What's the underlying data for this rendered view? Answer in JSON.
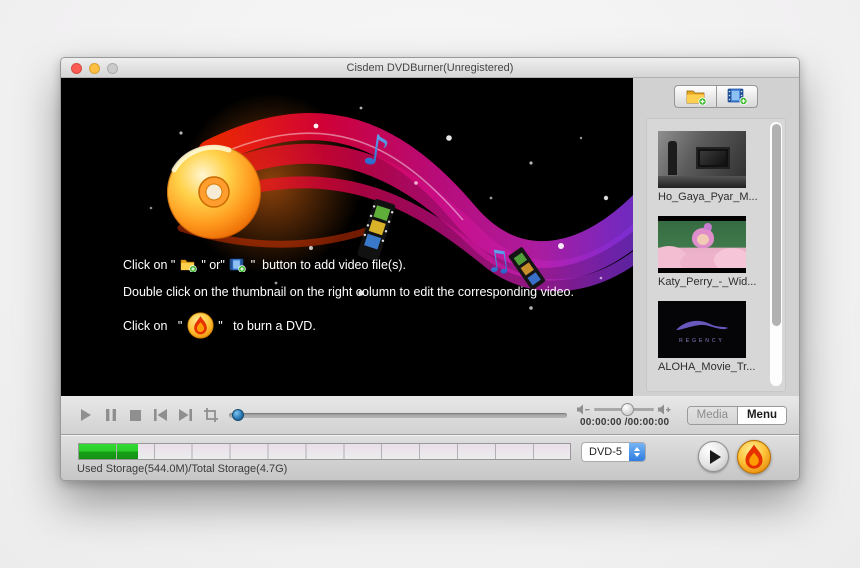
{
  "window": {
    "title": "Cisdem DVDBurner(Unregistered)",
    "traffic_lights": [
      "close",
      "minimize",
      "zoom-disabled"
    ]
  },
  "toolbar": {
    "add_folder_icon": "folder-plus-icon",
    "add_video_icon": "film-plus-icon"
  },
  "instructions": {
    "line1_pre": "Click on \" ",
    "line1_mid": " \" or\" ",
    "line1_post": " \"  button to add video file(s).",
    "line2": "Double click on the thumbnail on the right column to edit the corresponding video.",
    "line3_pre": "Click on   \" ",
    "line3_post": " \"   to burn a DVD."
  },
  "playlist": {
    "items": [
      {
        "label": "Ho_Gaya_Pyar_M...",
        "thumb": "black-white-room-scene"
      },
      {
        "label": "Katy_Perry_-_Wid...",
        "thumb": "pink-clouds-scene"
      },
      {
        "label": "ALOHA_Movie_Tr...",
        "thumb": "regency-logo",
        "logo_text": "REGENCY"
      }
    ]
  },
  "transport": {
    "icons": [
      "play",
      "pause",
      "stop",
      "previous",
      "next",
      "trim"
    ],
    "seek_percent": 1,
    "volume_percent": 46
  },
  "time": {
    "display": "00:00:00 /00:00:00"
  },
  "view_toggle": {
    "media_label": "Media",
    "menu_label": "Menu",
    "selected": "Menu"
  },
  "storage": {
    "label": "Used Storage(544.0M)/Total Storage(4.7G)",
    "used_percent": 12,
    "segments": 13
  },
  "disc_type": {
    "value": "DVD-5"
  },
  "colors": {
    "storage_green": "#2bce2b",
    "seek_knob_blue": "#2d7cb7",
    "stepper_blue": "#2f7de2",
    "burn_orange": "#ff9d00",
    "burn_red": "#e63000",
    "disc_gold": "#ffb322"
  }
}
